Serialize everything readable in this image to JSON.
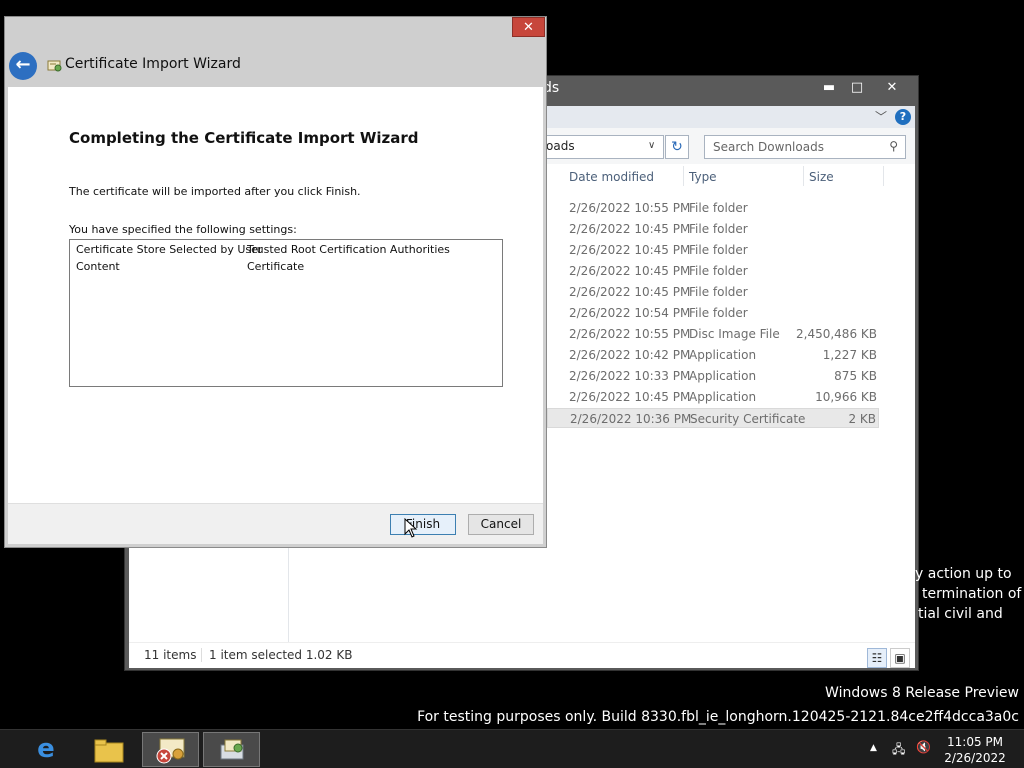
{
  "explorer": {
    "title_fragment": "ds",
    "controls": {
      "minimize": "▬",
      "maximize": "□",
      "close": "✕"
    },
    "address_fragment": "oads",
    "search_placeholder": "Search Downloads",
    "columns": {
      "date": "Date modified",
      "type": "Type",
      "size": "Size"
    },
    "rows": [
      {
        "date": "2/26/2022 10:55 PM",
        "type": "File folder",
        "size": ""
      },
      {
        "date": "2/26/2022 10:45 PM",
        "type": "File folder",
        "size": ""
      },
      {
        "date": "2/26/2022 10:45 PM",
        "type": "File folder",
        "size": ""
      },
      {
        "date": "2/26/2022 10:45 PM",
        "type": "File folder",
        "size": ""
      },
      {
        "date": "2/26/2022 10:45 PM",
        "type": "File folder",
        "size": ""
      },
      {
        "date": "2/26/2022 10:54 PM",
        "type": "File folder",
        "size": ""
      },
      {
        "date": "2/26/2022 10:55 PM",
        "type": "Disc Image File",
        "size": "2,450,486 KB"
      },
      {
        "date": "2/26/2022 10:42 PM",
        "type": "Application",
        "size": "1,227 KB"
      },
      {
        "date": "2/26/2022 10:33 PM",
        "type": "Application",
        "size": "875 KB"
      },
      {
        "date": "2/26/2022 10:45 PM",
        "type": "Application",
        "size": "10,966 KB"
      },
      {
        "date": "2/26/2022 10:36 PM",
        "type": "Security Certificate",
        "size": "2 KB"
      }
    ],
    "status": {
      "items": "11 items",
      "selected": "1 item selected  1.02 KB"
    }
  },
  "wizard": {
    "title": "Certificate Import Wizard",
    "heading": "Completing the Certificate Import Wizard",
    "info": "The certificate will be imported after you click Finish.",
    "settings_label": "You have specified the following settings:",
    "settings": [
      {
        "key": "Certificate Store Selected by User",
        "value": "Trusted Root Certification Authorities"
      },
      {
        "key": "Content",
        "value": "Certificate"
      }
    ],
    "finish_label": "Finish",
    "cancel_label": "Cancel",
    "close_glyph": "✕"
  },
  "background_text": [
    "y action up to",
    "termination of",
    "tial civil and"
  ],
  "watermark": {
    "line1": "Windows 8 Release Preview",
    "line2": "For testing purposes only. Build 8330.fbl_ie_longhorn.120425-2121.84ce2ff4dcca3a0c"
  },
  "taskbar": {
    "time": "11:05 PM",
    "date": "2/26/2022"
  },
  "colors": {
    "close_red": "#c7463b",
    "accent_blue": "#2d6fc1",
    "desktop": "#000000"
  }
}
